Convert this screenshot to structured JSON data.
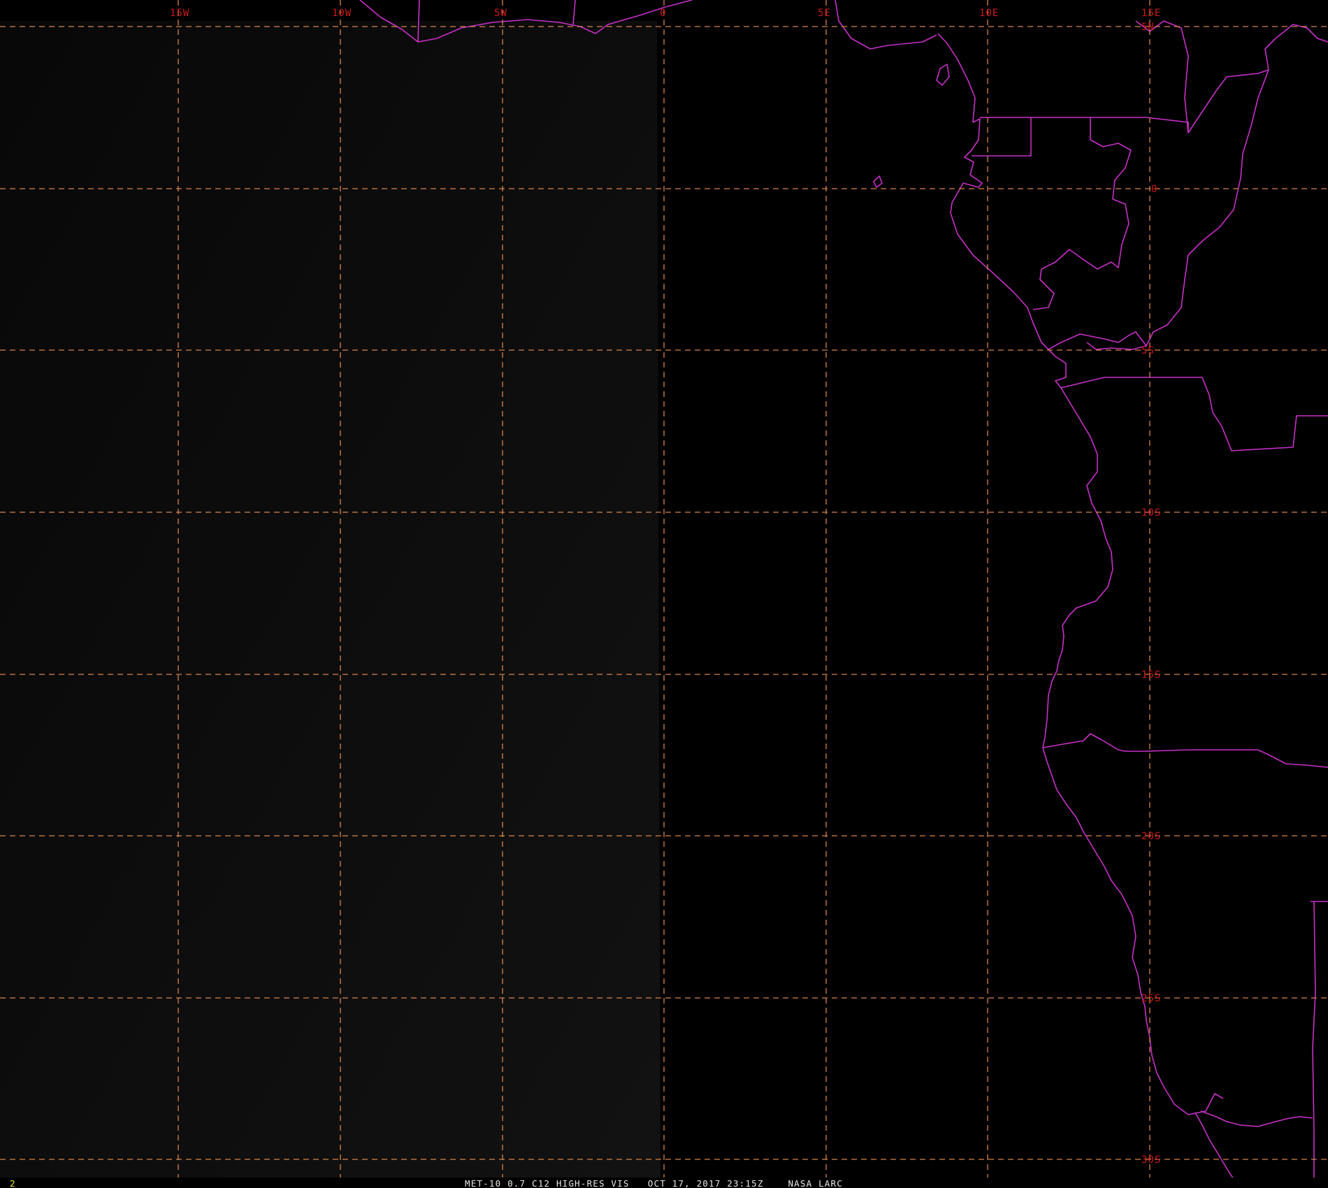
{
  "map": {
    "lon_labels": [
      "15W",
      "10W",
      "5W",
      "0",
      "5E",
      "10E",
      "15E"
    ],
    "lat_labels": [
      "5N",
      "0",
      "5S",
      "10S",
      "15S",
      "20S",
      "25S",
      "30S"
    ],
    "colors": {
      "background": "#000000",
      "graticule": "#d8844a",
      "grid_label": "#cc1a1a",
      "coastline": "#c830c8",
      "footer_text": "#e6e6e6",
      "frame_number": "#e6e61a"
    },
    "frame_number": "2",
    "footer": "MET-10 0.7 C12 HIGH-RES VIS   OCT 17, 2017 23:15Z    NASA LARC"
  }
}
